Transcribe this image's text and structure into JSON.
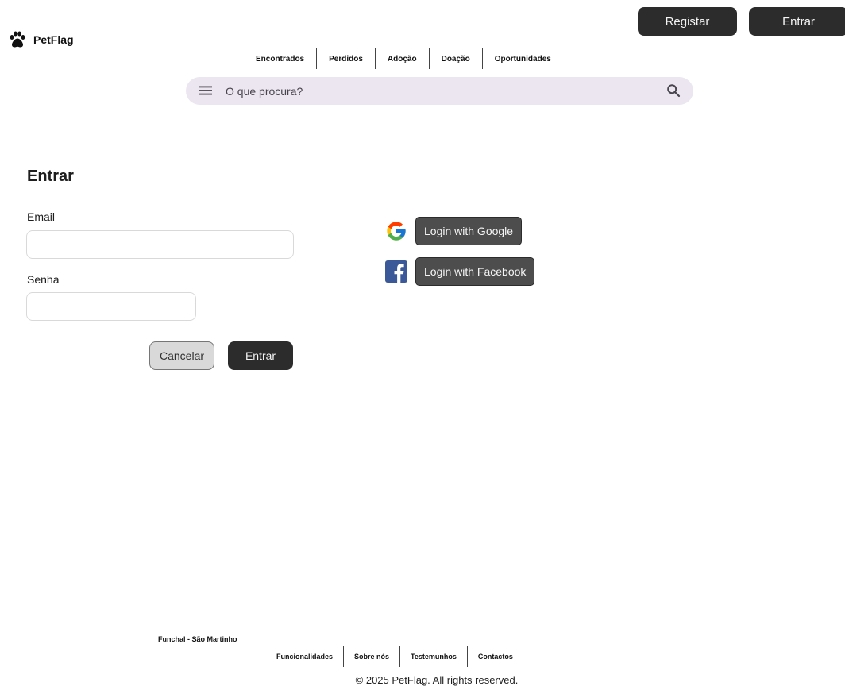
{
  "brand": {
    "name": "PetFlag",
    "logo_icon": "paw-icon"
  },
  "header": {
    "register_label": "Registar",
    "login_label": "Entrar"
  },
  "nav": {
    "items": [
      {
        "label": "Encontrados"
      },
      {
        "label": "Perdidos"
      },
      {
        "label": "Adoção"
      },
      {
        "label": "Doação"
      },
      {
        "label": "Oportunidades"
      }
    ]
  },
  "search": {
    "placeholder": "O que procura?",
    "menu_icon": "menu-icon",
    "search_icon": "search-icon"
  },
  "login_form": {
    "title": "Entrar",
    "email_label": "Email",
    "email_value": "",
    "password_label": "Senha",
    "password_value": "",
    "cancel_label": "Cancelar",
    "submit_label": "Entrar"
  },
  "social_login": {
    "google_label": "Login with Google",
    "google_icon": "google-icon",
    "facebook_label": "Login with Facebook",
    "facebook_icon": "facebook-icon"
  },
  "footer": {
    "location": "Funchal - São Martinho",
    "links": [
      {
        "label": "Funcionalidades"
      },
      {
        "label": "Sobre nós"
      },
      {
        "label": "Testemunhos"
      },
      {
        "label": "Contactos"
      }
    ],
    "copyright": "© 2025 PetFlag.  All rights reserved."
  },
  "colors": {
    "primary_button": "#2c2c2c",
    "search_background": "#ece6f0",
    "social_button": "#4d4d4d",
    "facebook_blue": "#3b5998"
  }
}
